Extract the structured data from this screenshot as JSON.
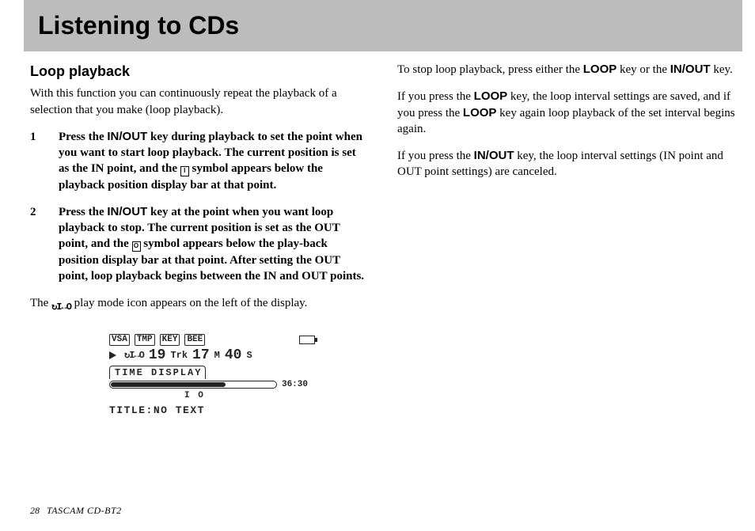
{
  "title": "Listening to CDs",
  "section": "Loop playback",
  "intro": "With this function you can continuously repeat the playback of a selection that you make (loop playback).",
  "keys": {
    "inout": "IN/OUT",
    "loop": "LOOP"
  },
  "steps": {
    "s1_a": "Press the ",
    "s1_b": " key during playback to set the point when you want to start loop playback. The current position is set as the IN point, and the ",
    "s1_c": " symbol appears below the playback position display bar at that point.",
    "s2_a": "Press the ",
    "s2_b": " key at the point when you want loop playback to stop. The current position is set as the OUT point, and the ",
    "s2_c": " symbol appears below the play-back position display bar at that point. After setting the OUT point, loop playback begins between the IN and OUT points."
  },
  "icon": {
    "i": "I",
    "o": "O"
  },
  "left_after_a": "The ",
  "left_after_b": " play mode icon appears on the left of the display.",
  "playmode_glyph": "↻I↔O",
  "right": {
    "p1_a": "To stop loop playback, press either the ",
    "p1_b": " key or the ",
    "p1_c": " key.",
    "p2_a": "If you press the ",
    "p2_b": " key, the loop interval settings are saved, and if you press the ",
    "p2_c": " key again loop playback of the set interval begins again.",
    "p3_a": "If you press the ",
    "p3_b": " key, the loop interval settings (IN point and OUT point settings) are canceled."
  },
  "lcd": {
    "chips": [
      "VSA",
      "TMP",
      "KEY",
      "BEE"
    ],
    "track": "19",
    "track_lbl": "Trk",
    "min": "17",
    "min_lbl": "M",
    "sec": "40",
    "sec_lbl": "S",
    "tab": "TIME DISPLAY",
    "endtime": "36:30",
    "marks": "I O",
    "title_lbl": "TITLE:",
    "title_val": "NO TEXT"
  },
  "footer": {
    "page": "28",
    "model": "TASCAM  CD-BT2"
  }
}
